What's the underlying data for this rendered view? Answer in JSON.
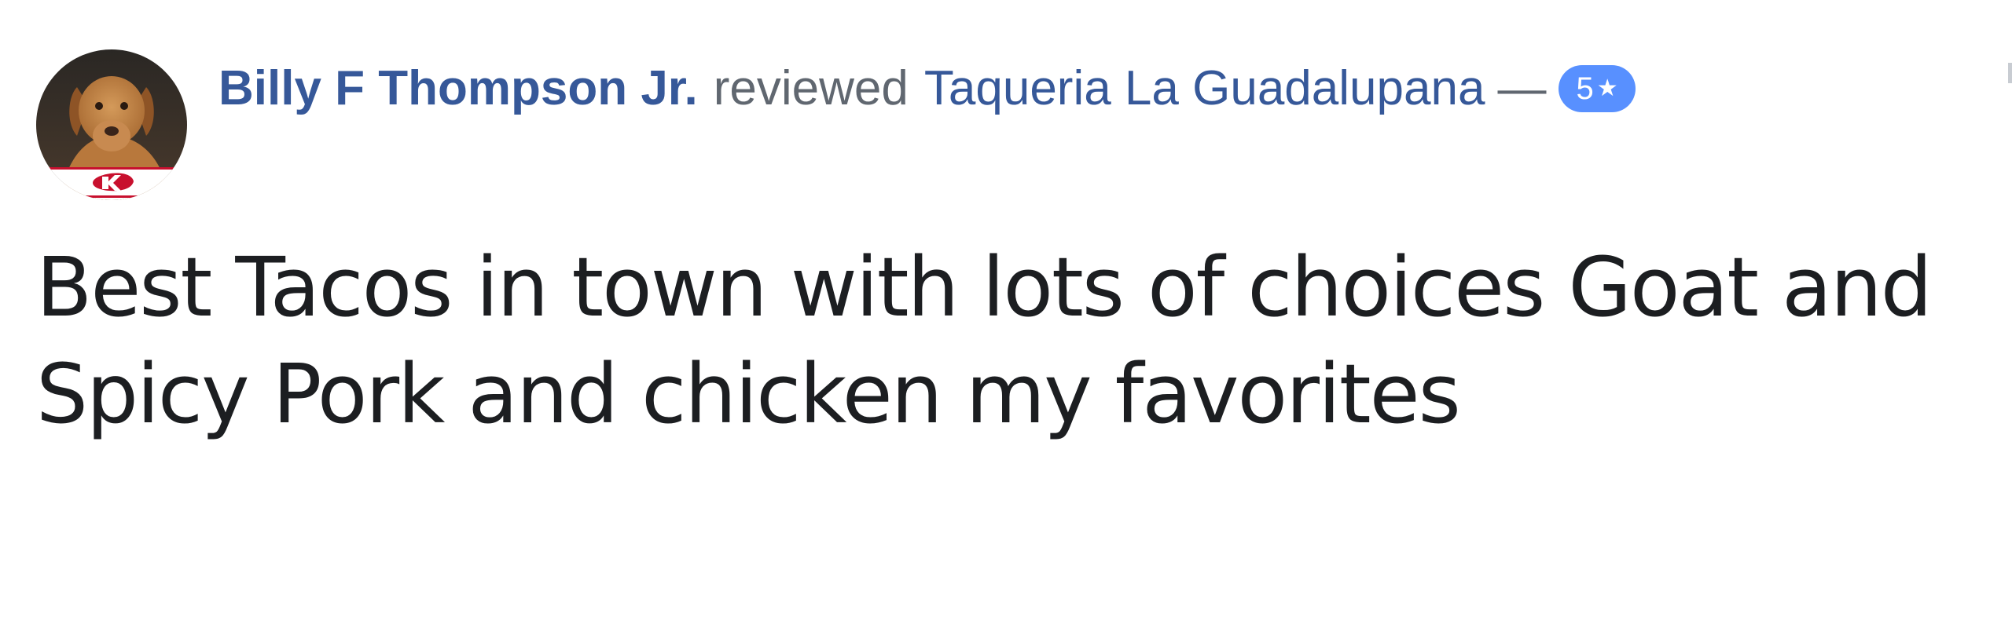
{
  "review": {
    "reviewer_name": "Billy F Thompson Jr.",
    "action": "reviewed",
    "page_name": "Taqueria La Guadalupana",
    "separator": "—",
    "rating": "5",
    "rating_icon": "star-icon",
    "text": "Best Tacos in town with lots of choices Goat and Spicy Pork and chicken my favorites"
  },
  "colors": {
    "link": "#365899",
    "secondary_text": "#606770",
    "body_text": "#1c1e21",
    "rating_badge": "#5890ff"
  }
}
